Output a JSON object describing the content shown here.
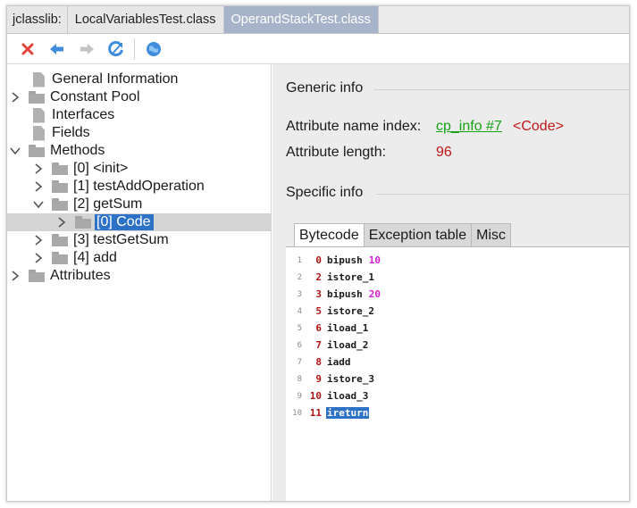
{
  "tabs": [
    {
      "label": "jclasslib:"
    },
    {
      "label": "LocalVariablesTest.class"
    },
    {
      "label": "OperandStackTest.class"
    }
  ],
  "toolbar": {
    "icons": [
      "close-icon",
      "back-icon",
      "forward-icon",
      "reload-icon",
      "web-icon"
    ]
  },
  "tree": {
    "general_information": "General Information",
    "constant_pool": "Constant Pool",
    "interfaces": "Interfaces",
    "fields": "Fields",
    "methods": "Methods",
    "method_init": "[0] <init>",
    "method_test_add": "[1] testAddOperation",
    "method_get_sum": "[2] getSum",
    "code": "[0] Code",
    "method_test_get_sum": "[3] testGetSum",
    "method_add": "[4] add",
    "attributes": "Attributes"
  },
  "generic_info": {
    "title": "Generic info",
    "name_index_label": "Attribute name index:",
    "name_index_link": "cp_info #7",
    "name_index_value": "<Code>",
    "length_label": "Attribute length:",
    "length_value": "96"
  },
  "specific_info": {
    "title": "Specific info",
    "tabs": [
      "Bytecode",
      "Exception table",
      "Misc"
    ],
    "active_tab": "Bytecode"
  },
  "bytecode": [
    {
      "line": "1",
      "offset": "0",
      "op": "bipush",
      "arg": "10"
    },
    {
      "line": "2",
      "offset": "2",
      "op": "istore_1",
      "arg": ""
    },
    {
      "line": "3",
      "offset": "3",
      "op": "bipush",
      "arg": "20"
    },
    {
      "line": "4",
      "offset": "5",
      "op": "istore_2",
      "arg": ""
    },
    {
      "line": "5",
      "offset": "6",
      "op": "iload_1",
      "arg": ""
    },
    {
      "line": "6",
      "offset": "7",
      "op": "iload_2",
      "arg": ""
    },
    {
      "line": "7",
      "offset": "8",
      "op": "iadd",
      "arg": ""
    },
    {
      "line": "8",
      "offset": "9",
      "op": "istore_3",
      "arg": ""
    },
    {
      "line": "9",
      "offset": "10",
      "op": "iload_3",
      "arg": ""
    },
    {
      "line": "10",
      "offset": "11",
      "op": "ireturn",
      "arg": ""
    }
  ],
  "colors": {
    "link": "#15a315",
    "value_red": "#c01616",
    "selection": "#2d72c6",
    "operand": "#d41fd4"
  }
}
